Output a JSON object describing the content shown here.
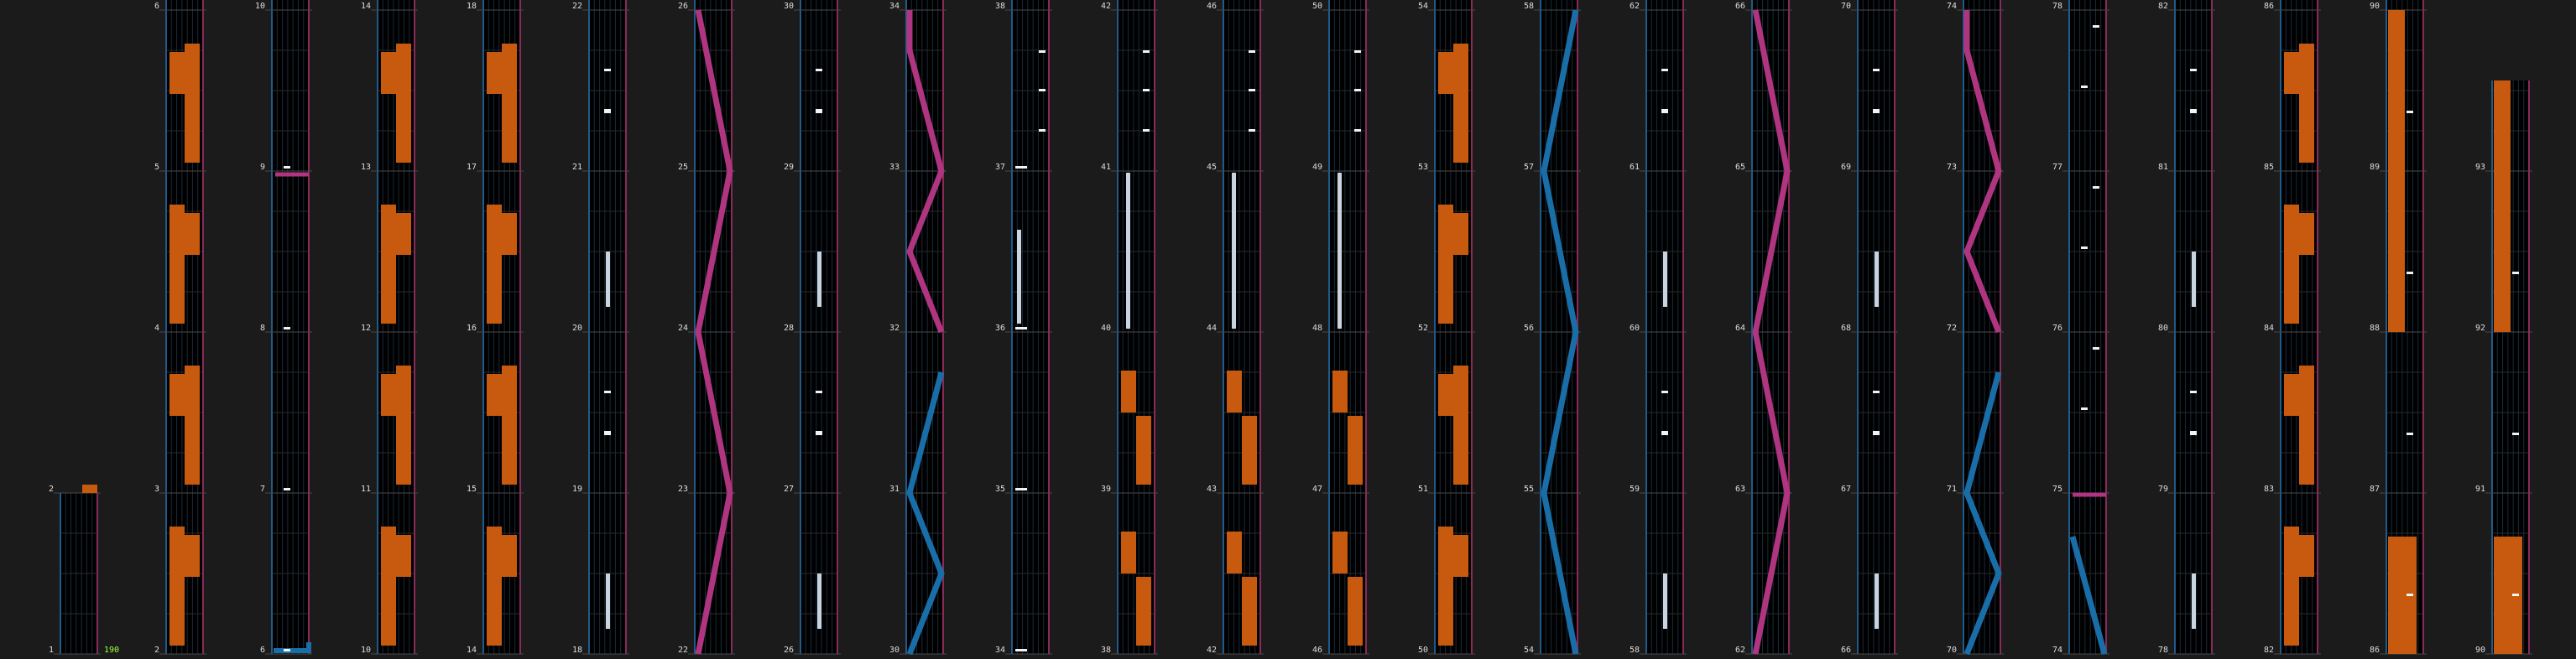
{
  "app": {
    "kind": "rhythm-chart-viewer"
  },
  "colors": {
    "background": "#1b1b1b",
    "lane_bg": "#000000",
    "grid": "#1a2a3a",
    "left_border": "#1f5a8a",
    "right_border": "#8a2a5a",
    "measure_line": "#4a4a4a",
    "note_white": "#f2f2f2",
    "long_note": "#c8d4e0",
    "scratch_blue": "#1a6ea8",
    "scratch_pink": "#b03580",
    "bgm_orange": "#c85a10",
    "bgm_label_green": "#a0ff40",
    "label": "#dddddd"
  },
  "bpm_label": "190",
  "chart_data": {
    "type": "rhythm-game-chart",
    "measures_per_column": 4,
    "columns": [
      {
        "measures": [
          "1",
          "2"
        ]
      },
      {
        "measures": [
          "2",
          "3",
          "4",
          "5",
          "6"
        ]
      },
      {
        "measures": [
          "6",
          "7",
          "8",
          "9",
          "10"
        ]
      },
      {
        "measures": [
          "10",
          "11",
          "12",
          "13",
          "14"
        ]
      },
      {
        "measures": [
          "14",
          "15",
          "16",
          "17",
          "18"
        ]
      },
      {
        "measures": [
          "18",
          "19",
          "20",
          "21",
          "22"
        ]
      },
      {
        "measures": [
          "22",
          "23",
          "24",
          "25",
          "26"
        ]
      },
      {
        "measures": [
          "26",
          "27",
          "28",
          "29",
          "30"
        ]
      },
      {
        "measures": [
          "30",
          "31",
          "32",
          "33",
          "34"
        ]
      },
      {
        "measures": [
          "34",
          "35",
          "36",
          "37",
          "38"
        ]
      },
      {
        "measures": [
          "38",
          "39",
          "40",
          "41",
          "42"
        ]
      },
      {
        "measures": [
          "42",
          "43",
          "44",
          "45",
          "46"
        ]
      },
      {
        "measures": [
          "46",
          "47",
          "48",
          "49",
          "50"
        ]
      },
      {
        "measures": [
          "50",
          "51",
          "52",
          "53",
          "54"
        ]
      },
      {
        "measures": [
          "54",
          "55",
          "56",
          "57",
          "58"
        ]
      },
      {
        "measures": [
          "58",
          "59",
          "60",
          "61",
          "62"
        ]
      },
      {
        "measures": [
          "62",
          "63",
          "64",
          "65",
          "66"
        ]
      },
      {
        "measures": [
          "66",
          "67",
          "68",
          "69",
          "70"
        ]
      },
      {
        "measures": [
          "70",
          "71",
          "72",
          "73",
          "74"
        ]
      },
      {
        "measures": [
          "74",
          "75",
          "76",
          "77",
          "78"
        ]
      },
      {
        "measures": [
          "78",
          "79",
          "80",
          "81",
          "82"
        ]
      },
      {
        "measures": [
          "82",
          "83",
          "84",
          "85",
          "86"
        ]
      },
      {
        "measures": [
          "86",
          "87",
          "88",
          "89",
          "90"
        ]
      },
      {
        "measures": [
          "90",
          "91",
          "92",
          "93"
        ]
      }
    ],
    "patterns": [
      {
        "col": 0,
        "type": "orange-bar"
      },
      {
        "col": 1,
        "type": "orange-blocks"
      },
      {
        "col": 2,
        "type": "scratch-corner"
      },
      {
        "col": 3,
        "type": "orange-blocks"
      },
      {
        "col": 4,
        "type": "orange-blocks"
      },
      {
        "col": 5,
        "type": "long-notes"
      },
      {
        "col": 6,
        "type": "zigzag-pink"
      },
      {
        "col": 7,
        "type": "long-notes"
      },
      {
        "col": 8,
        "type": "zigzag-mixed"
      },
      {
        "col": 9,
        "type": "white-notes"
      },
      {
        "col": 10,
        "type": "long-orange"
      },
      {
        "col": 11,
        "type": "long-orange"
      },
      {
        "col": 12,
        "type": "long-orange"
      },
      {
        "col": 13,
        "type": "orange-blocks"
      },
      {
        "col": 14,
        "type": "zigzag-blue"
      },
      {
        "col": 15,
        "type": "long-notes"
      },
      {
        "col": 16,
        "type": "zigzag-pink"
      },
      {
        "col": 17,
        "type": "long-notes"
      },
      {
        "col": 18,
        "type": "zigzag-mixed"
      },
      {
        "col": 19,
        "type": "scratch-mix"
      },
      {
        "col": 20,
        "type": "long-notes"
      },
      {
        "col": 21,
        "type": "orange-blocks"
      },
      {
        "col": 22,
        "type": "orange-long"
      },
      {
        "col": 23,
        "type": "orange-long"
      }
    ]
  }
}
